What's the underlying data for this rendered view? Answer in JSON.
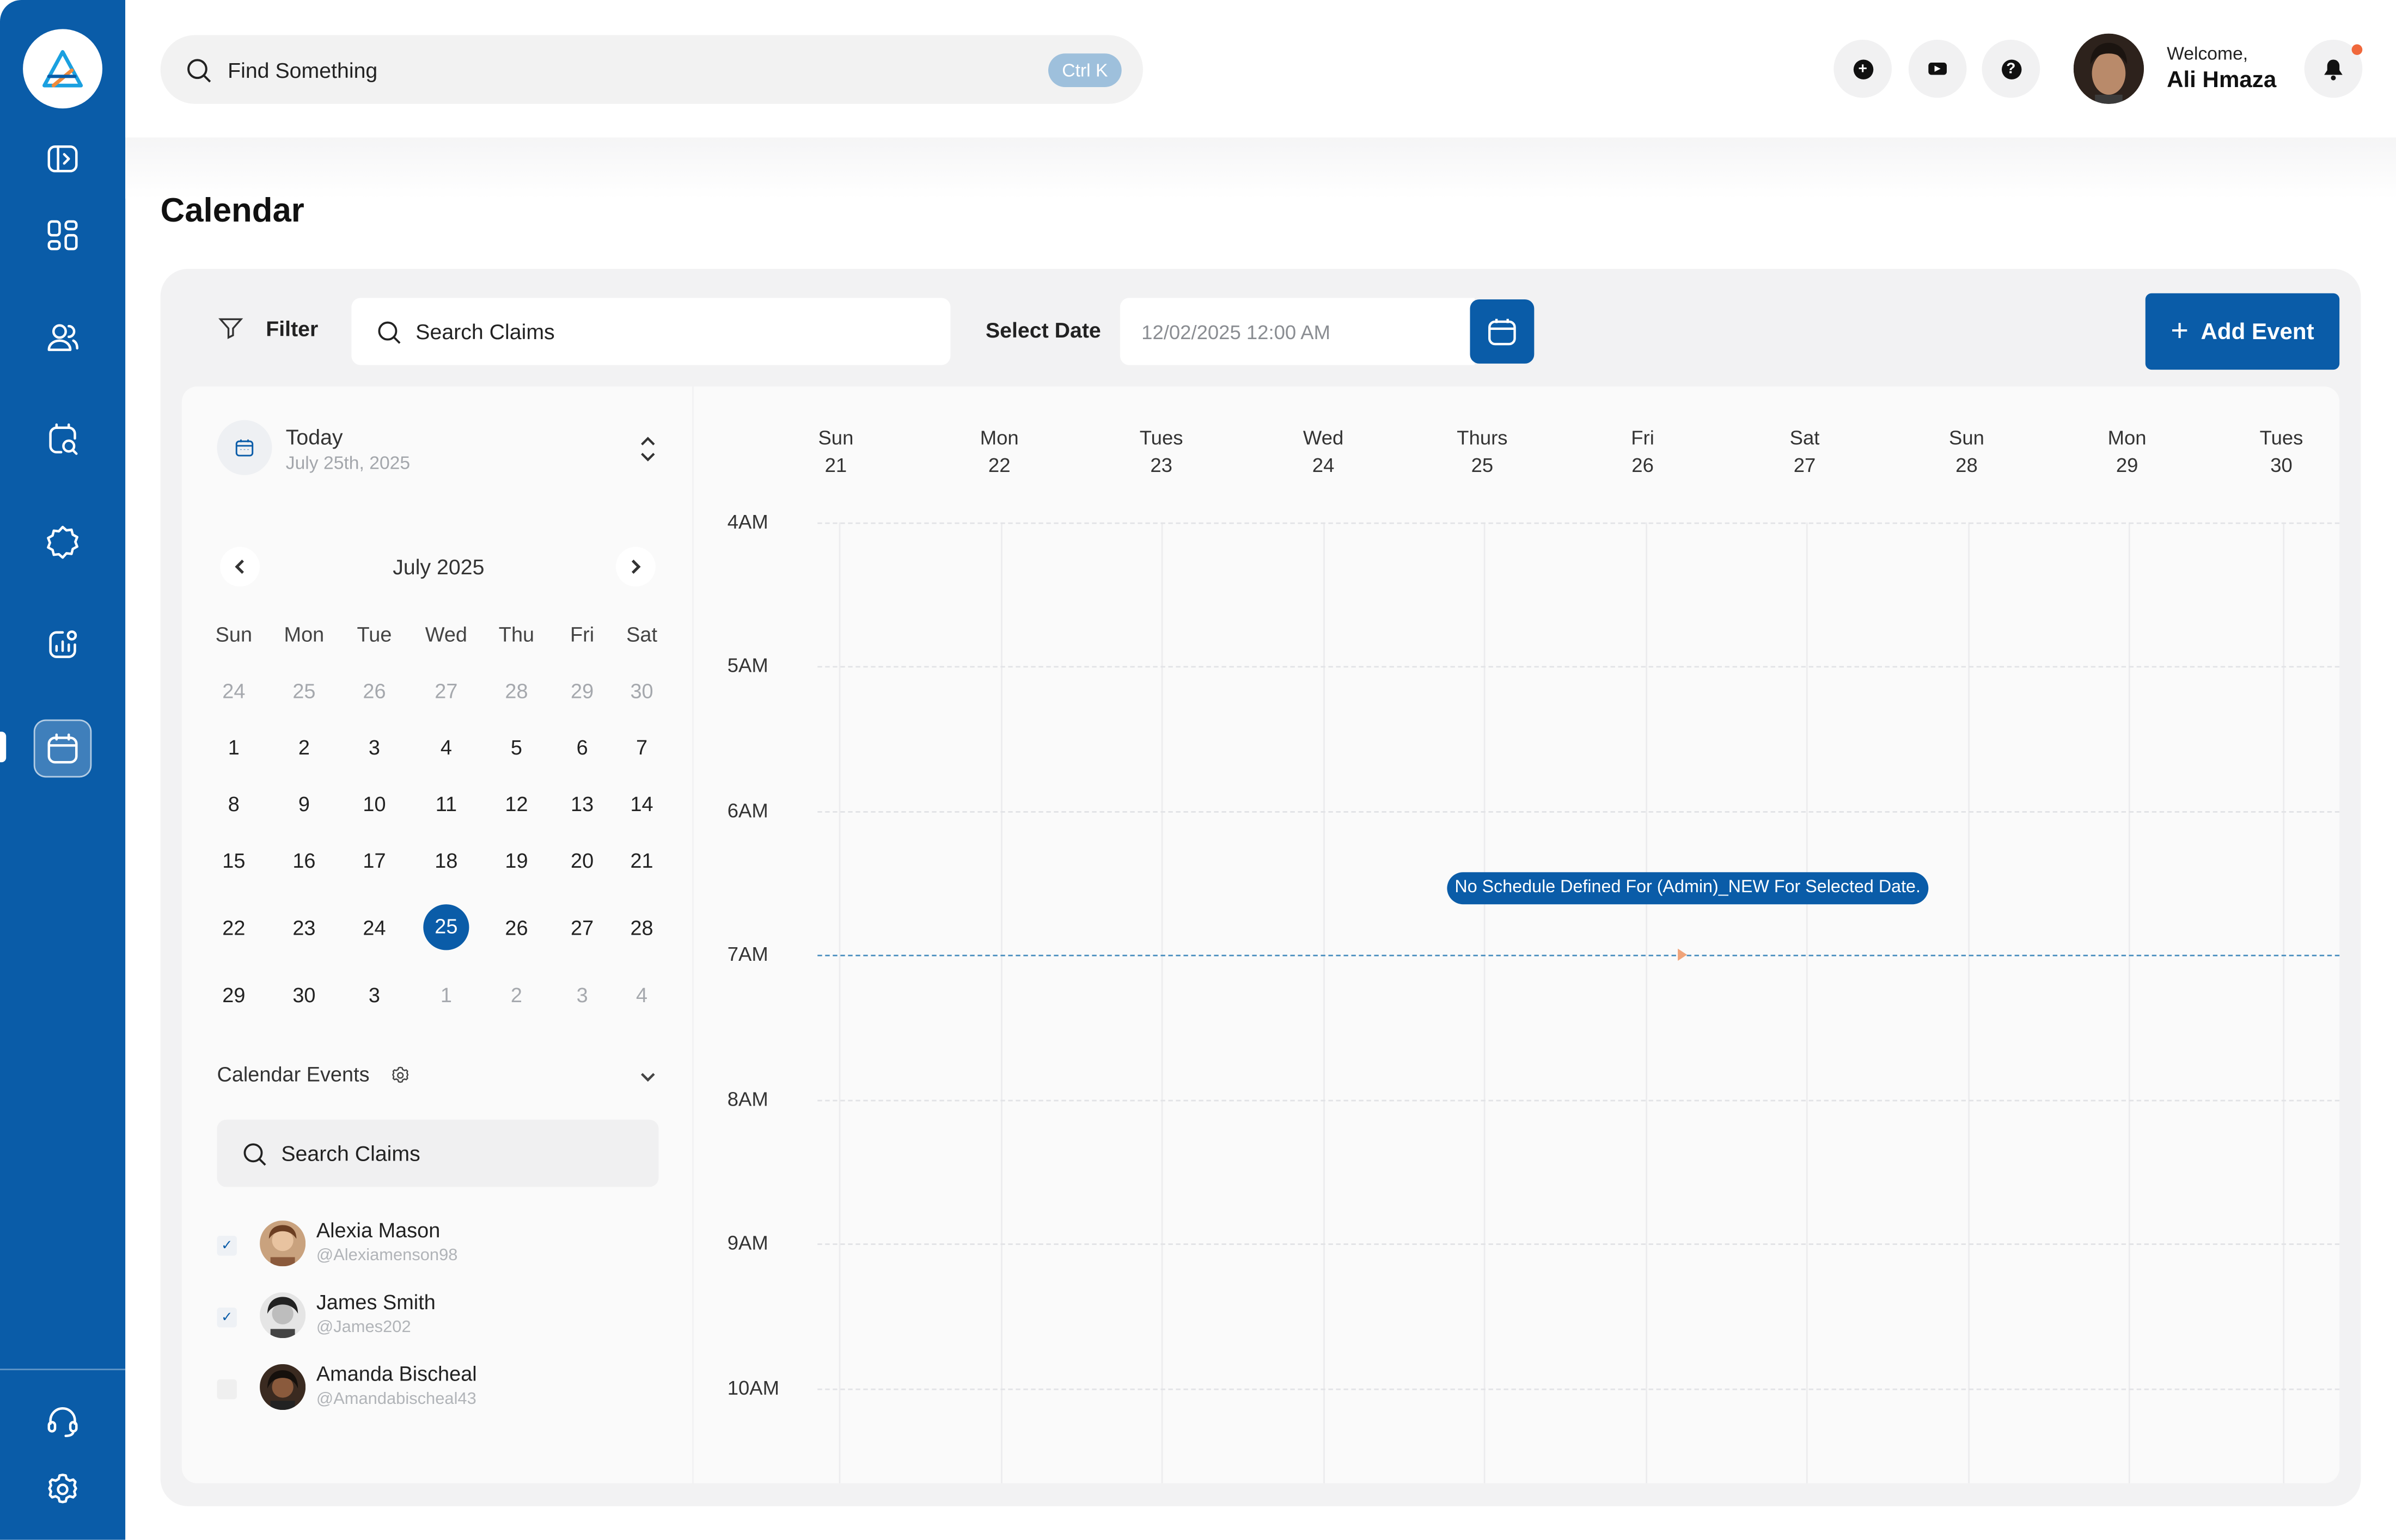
{
  "header": {
    "search_placeholder": "Find Something",
    "shortcut": "Ctrl K",
    "welcome": "Welcome,",
    "username": "Ali Hmaza"
  },
  "sidebar": {
    "nav_icons": [
      "sidebar-toggle-icon",
      "dashboard-grid-icon",
      "users-icon",
      "search-document-icon",
      "badge-icon",
      "reports-icon",
      "calendar-icon"
    ],
    "bottom_icons": [
      "headset-icon",
      "gear-icon"
    ],
    "active": "calendar-icon"
  },
  "page": {
    "title": "Calendar"
  },
  "toolbar": {
    "filter_label": "Filter",
    "search_placeholder": "Search Claims",
    "select_date_label": "Select Date",
    "date_value": "12/02/2025 12:00 AM",
    "add_event_label": "Add Event"
  },
  "today": {
    "label": "Today",
    "date": "July 25th, 2025"
  },
  "mini_calendar": {
    "month": "July 2025",
    "weekdays": [
      "Sun",
      "Mon",
      "Tue",
      "Wed",
      "Thu",
      "Fri",
      "Sat"
    ],
    "weeks": [
      [
        "24",
        "25",
        "26",
        "27",
        "28",
        "29",
        "30"
      ],
      [
        "1",
        "2",
        "3",
        "4",
        "5",
        "6",
        "7"
      ],
      [
        "8",
        "9",
        "10",
        "11",
        "12",
        "13",
        "14"
      ],
      [
        "15",
        "16",
        "17",
        "18",
        "19",
        "20",
        "21"
      ],
      [
        "22",
        "23",
        "24",
        "25",
        "26",
        "27",
        "28"
      ],
      [
        "29",
        "30",
        "3",
        "1",
        "2",
        "3",
        "4"
      ]
    ],
    "selected": "25"
  },
  "events": {
    "header": "Calendar Events",
    "search_placeholder": "Search Claims",
    "people": [
      {
        "name": "Alexia Mason",
        "handle": "@Alexiamenson98",
        "checked": true
      },
      {
        "name": "James Smith",
        "handle": "@James202",
        "checked": true
      },
      {
        "name": "Amanda Bischeal",
        "handle": "@Amandabischeal43",
        "checked": false
      }
    ]
  },
  "schedule": {
    "columns": [
      {
        "day": "Sun",
        "date": "21"
      },
      {
        "day": "Mon",
        "date": "22"
      },
      {
        "day": "Tues",
        "date": "23"
      },
      {
        "day": "Wed",
        "date": "24"
      },
      {
        "day": "Thurs",
        "date": "25"
      },
      {
        "day": "Fri",
        "date": "26"
      },
      {
        "day": "Sat",
        "date": "27"
      },
      {
        "day": "Sun",
        "date": "28"
      },
      {
        "day": "Mon",
        "date": "29"
      },
      {
        "day": "Tues",
        "date": "30"
      }
    ],
    "hours": [
      "4AM",
      "5AM",
      "6AM",
      "7AM",
      "8AM",
      "9AM",
      "10AM"
    ],
    "notice": "No Schedule Defined For (Admin)_NEW For Selected Date."
  },
  "colors": {
    "accent": "#0a5ca8"
  }
}
